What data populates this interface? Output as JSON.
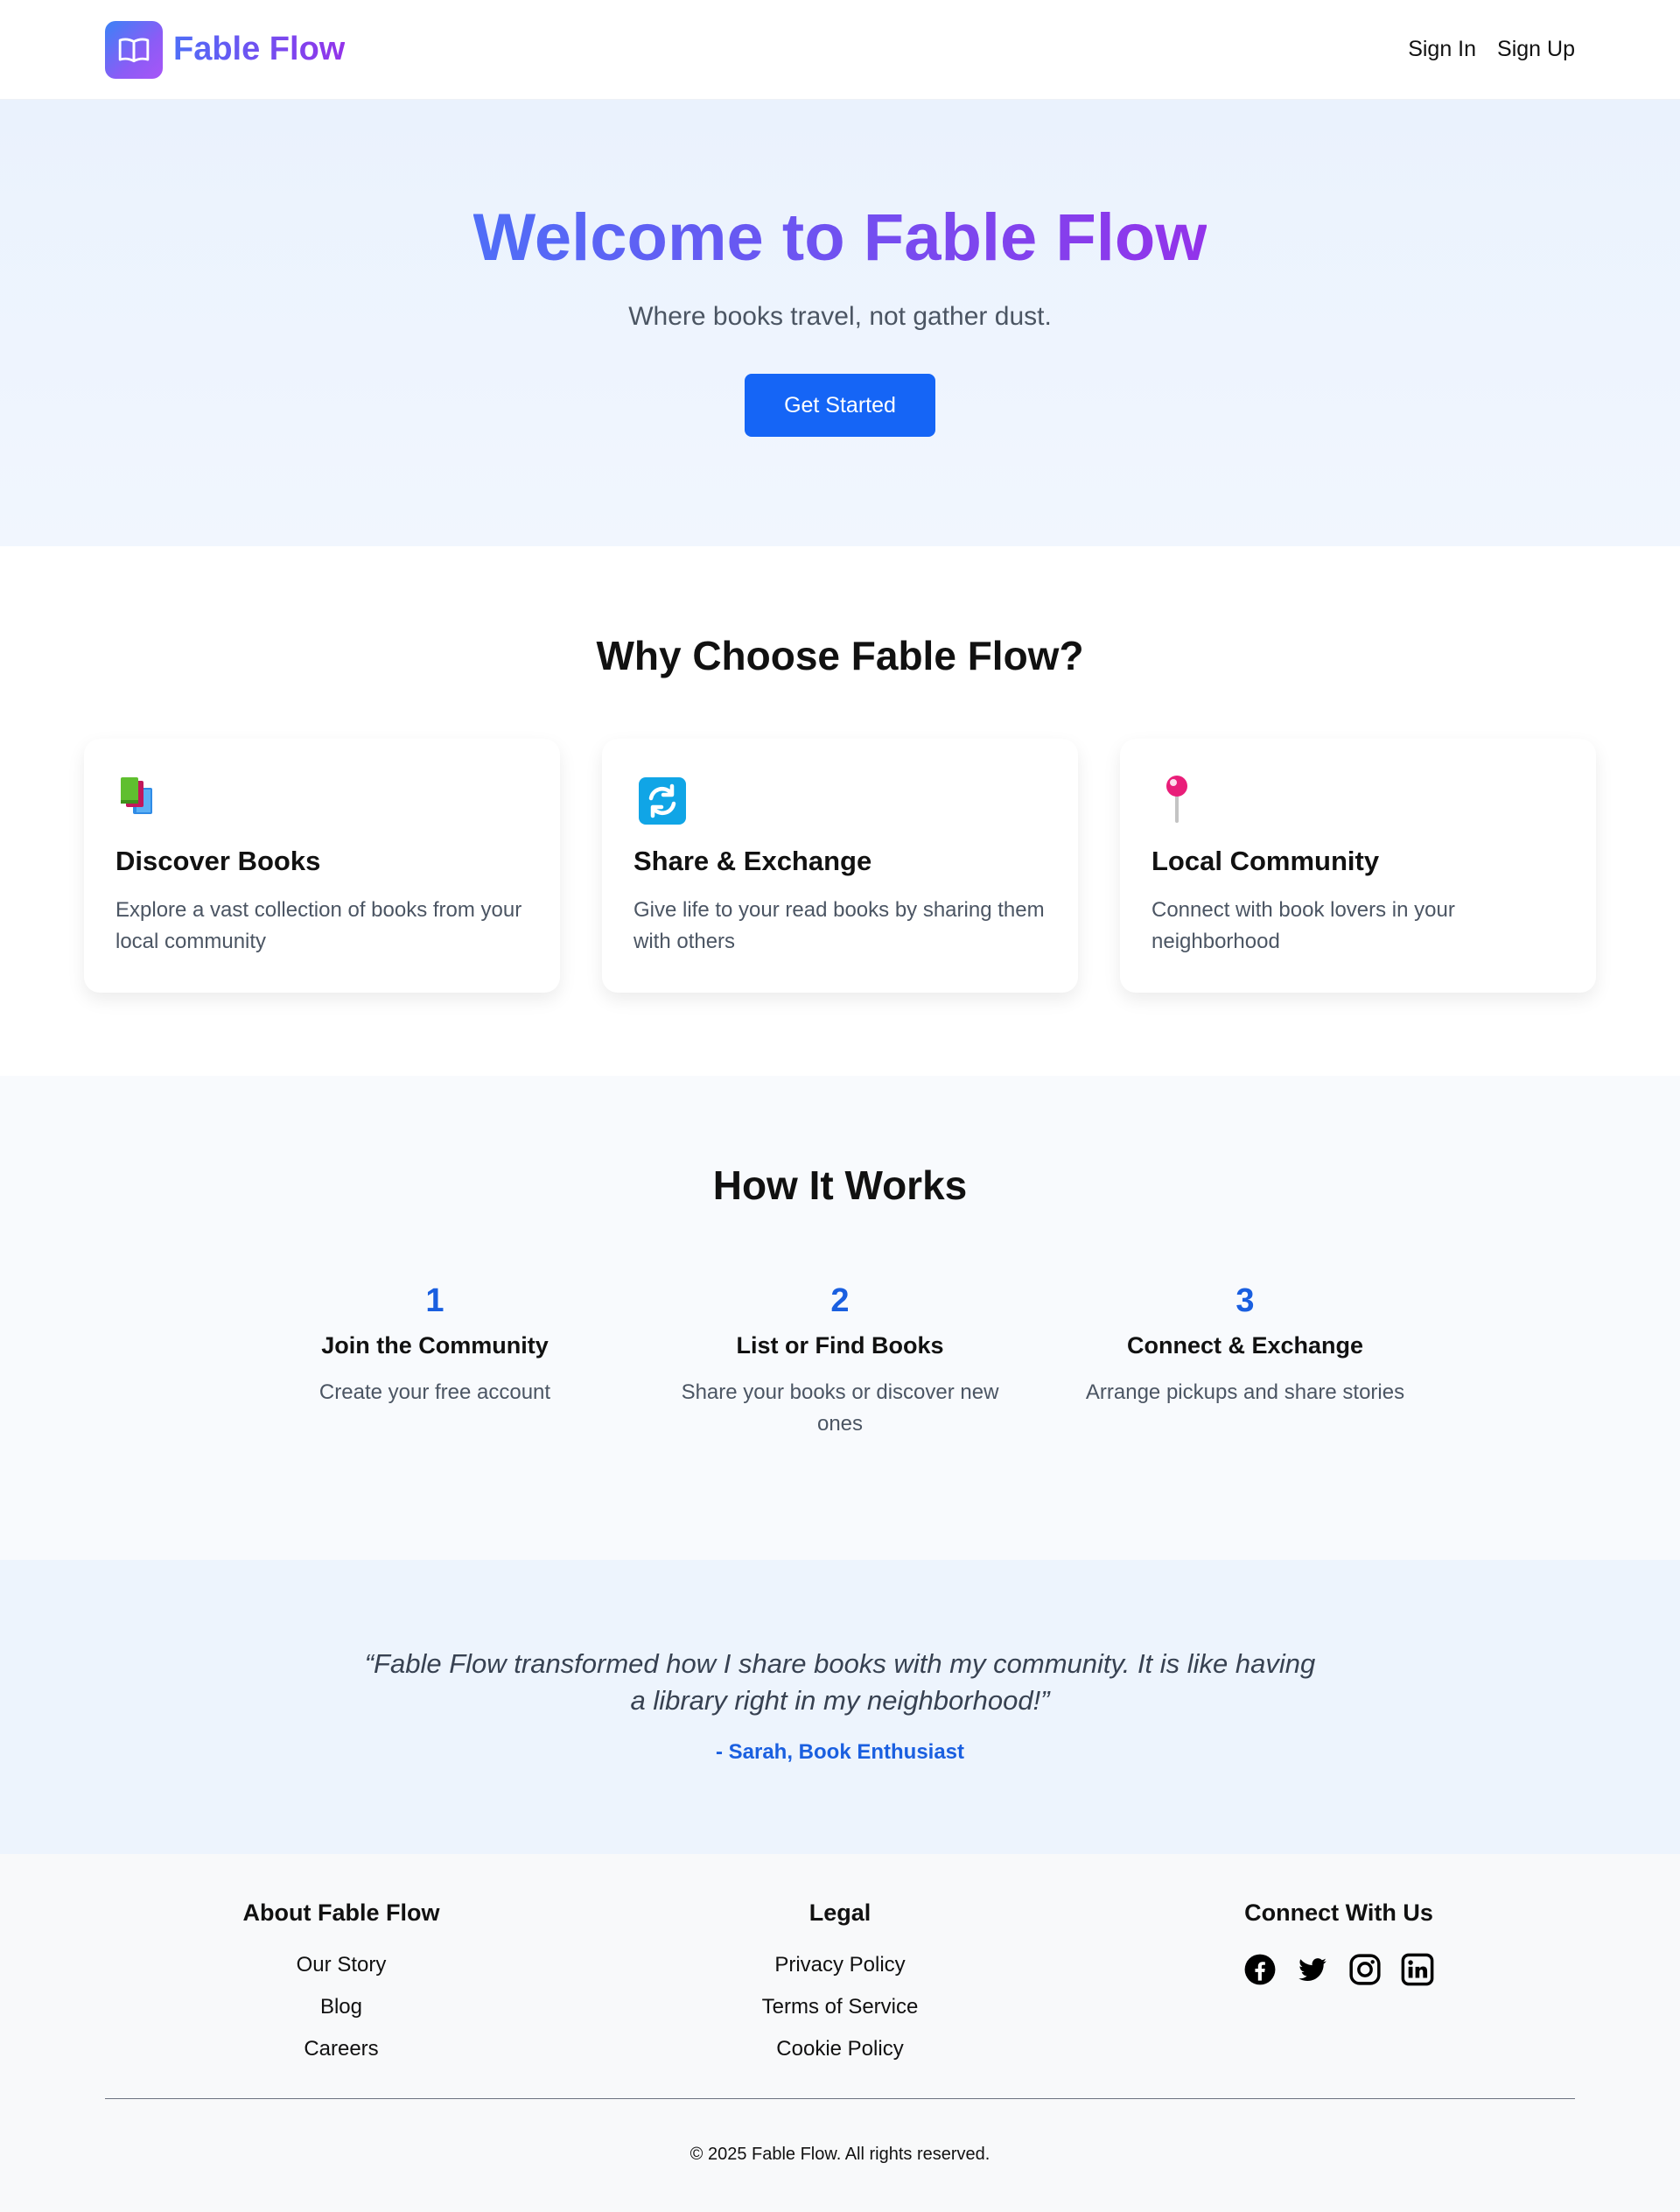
{
  "header": {
    "brand": "Fable Flow",
    "nav": {
      "sign_in": "Sign In",
      "sign_up": "Sign Up"
    }
  },
  "hero": {
    "title": "Welcome to Fable Flow",
    "subtitle": "Where books travel, not gather dust.",
    "cta": "Get Started"
  },
  "features": {
    "title": "Why Choose Fable Flow?",
    "cards": [
      {
        "icon": "books-icon",
        "title": "Discover Books",
        "text": "Explore a vast collection of books from your local community"
      },
      {
        "icon": "exchange-icon",
        "title": "Share & Exchange",
        "text": "Give life to your read books by sharing them with others"
      },
      {
        "icon": "pushpin-icon",
        "title": "Local Community",
        "text": "Connect with book lovers in your neighborhood"
      }
    ]
  },
  "how": {
    "title": "How It Works",
    "steps": [
      {
        "num": "1",
        "title": "Join the Community",
        "text": "Create your free account"
      },
      {
        "num": "2",
        "title": "List or Find Books",
        "text": "Share your books or discover new ones"
      },
      {
        "num": "3",
        "title": "Connect & Exchange",
        "text": "Arrange pickups and share stories"
      }
    ]
  },
  "testimonial": {
    "quote": "“Fable Flow transformed how I share books with my community. It is like having a library right in my neighborhood!”",
    "author": "- Sarah, Book Enthusiast"
  },
  "footer": {
    "about": {
      "title": "About Fable Flow",
      "links": [
        "Our Story",
        "Blog",
        "Careers"
      ]
    },
    "legal": {
      "title": "Legal",
      "links": [
        "Privacy Policy",
        "Terms of Service",
        "Cookie Policy"
      ]
    },
    "connect": {
      "title": "Connect With Us",
      "icons": [
        "facebook-icon",
        "twitter-icon",
        "instagram-icon",
        "linkedin-icon"
      ]
    },
    "copyright": "© 2025 Fable Flow. All rights reserved."
  },
  "colors": {
    "primary": "#1565f6",
    "accent_blue": "#1a5fe0",
    "gradient_start": "#4f6ef7",
    "gradient_end": "#9333ea",
    "hero_bg": "#eaf2fd"
  }
}
